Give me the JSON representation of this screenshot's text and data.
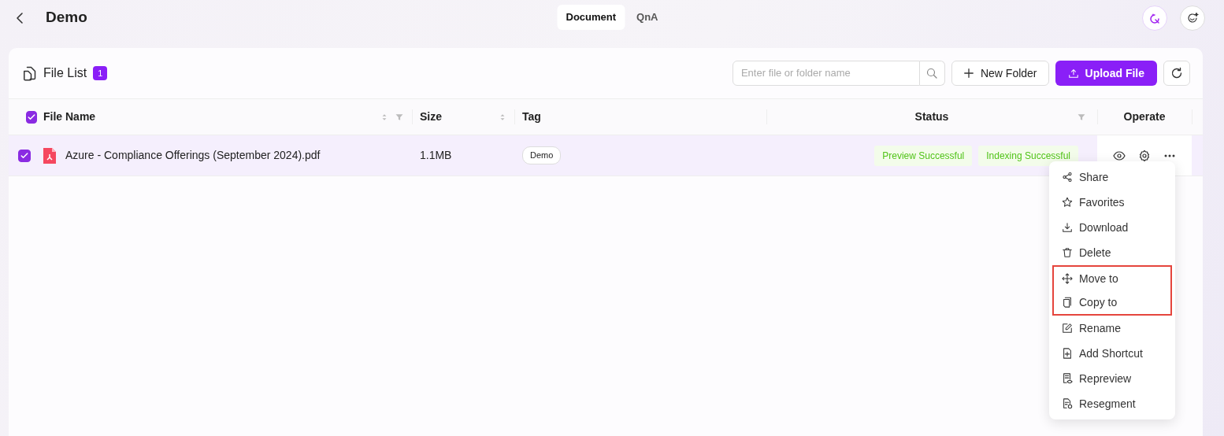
{
  "header": {
    "title": "Demo",
    "tabs": [
      {
        "label": "Document",
        "selected": true
      },
      {
        "label": "QnA",
        "selected": false
      }
    ]
  },
  "file_list": {
    "title": "File List",
    "count": "1",
    "search": {
      "placeholder": "Enter file or folder name"
    },
    "buttons": [
      {
        "label": "New Folder",
        "kind": "outline"
      },
      {
        "label": "Upload File",
        "kind": "primary"
      }
    ]
  },
  "table": {
    "all_checked": true,
    "columns": [
      {
        "label": "File Name",
        "sortable": true,
        "filterable": true
      },
      {
        "label": "Size",
        "sortable": true,
        "filterable": false
      },
      {
        "label": "Tag",
        "sortable": false,
        "filterable": false
      },
      {
        "label": "Status",
        "sortable": false,
        "filterable": true
      },
      {
        "label": "Operate",
        "sortable": false,
        "filterable": false
      }
    ],
    "rows": [
      {
        "checked": true,
        "file_name": "Azure - Compliance Offerings (September 2024).pdf",
        "size": "1.1MB",
        "tag": "Demo",
        "statuses": [
          "Preview Successful",
          "Indexing Successful"
        ]
      }
    ]
  },
  "menu": {
    "items": [
      {
        "label": "Share",
        "kind": "share",
        "highlighted": false
      },
      {
        "label": "Favorites",
        "kind": "star",
        "highlighted": false
      },
      {
        "label": "Download",
        "kind": "download",
        "highlighted": false
      },
      {
        "label": "Delete",
        "kind": "trash",
        "highlighted": false
      },
      {
        "label": "Move to",
        "kind": "move",
        "highlighted": true
      },
      {
        "label": "Copy to",
        "kind": "copy",
        "highlighted": true
      },
      {
        "label": "Rename",
        "kind": "edit",
        "highlighted": false
      },
      {
        "label": "Add Shortcut",
        "kind": "addfile",
        "highlighted": false
      },
      {
        "label": "Repreview",
        "kind": "preview",
        "highlighted": false
      },
      {
        "label": "Resegment",
        "kind": "segment",
        "highlighted": false
      }
    ]
  }
}
